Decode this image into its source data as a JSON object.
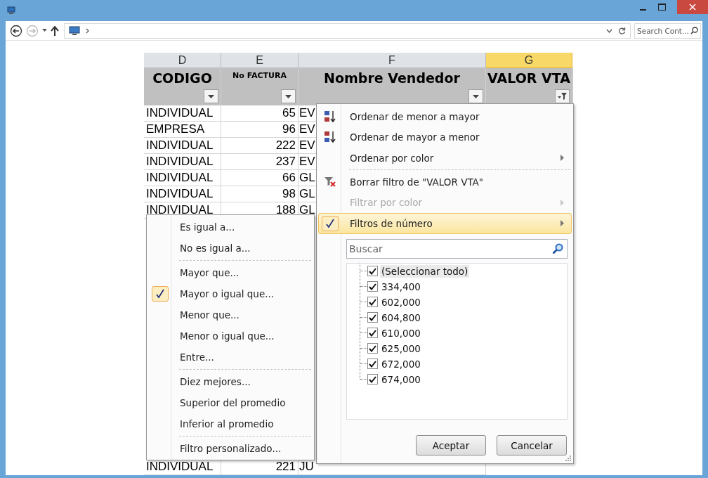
{
  "address_bar": {
    "search": {
      "placeholder": "Search Cont..."
    }
  },
  "sheet": {
    "columns": [
      {
        "letter": "D",
        "header": "CODIGO",
        "selected": false,
        "filtered": false
      },
      {
        "letter": "E",
        "header": "No FACTURA",
        "selected": false,
        "filtered": false
      },
      {
        "letter": "F",
        "header": "Nombre Vendedor",
        "selected": false,
        "filtered": false
      },
      {
        "letter": "G",
        "header": "VALOR VTA",
        "selected": true,
        "filtered": true
      }
    ],
    "rows": [
      {
        "cells": [
          "INDIVIDUAL",
          "65",
          "EV"
        ]
      },
      {
        "cells": [
          "EMPRESA",
          "96",
          "EV"
        ]
      },
      {
        "cells": [
          "INDIVIDUAL",
          "222",
          "EV"
        ]
      },
      {
        "cells": [
          "INDIVIDUAL",
          "237",
          "EV"
        ]
      },
      {
        "cells": [
          "INDIVIDUAL",
          "66",
          "GL"
        ]
      },
      {
        "cells": [
          "INDIVIDUAL",
          "98",
          "GL"
        ]
      },
      {
        "cells": [
          "INDIVIDUAL",
          "188",
          "GL"
        ]
      }
    ],
    "last_row": {
      "cells": [
        "INDIVIDUAL",
        "221",
        "JU"
      ]
    }
  },
  "filter_menu": {
    "items": [
      {
        "kind": "sort-ascending",
        "label": "Ordenar de menor a mayor",
        "disabled": false,
        "selected": false,
        "checked": false,
        "submenu": false
      },
      {
        "kind": "sort-descending",
        "label": "Ordenar de mayor a menor",
        "disabled": false,
        "selected": false,
        "checked": false,
        "submenu": false
      },
      {
        "kind": "command",
        "label": "Ordenar por color",
        "disabled": false,
        "selected": false,
        "checked": false,
        "submenu": true
      },
      {
        "kind": "separator"
      },
      {
        "kind": "clear-filter",
        "label": "Borrar filtro de \"VALOR VTA\"",
        "disabled": false,
        "selected": false,
        "checked": false,
        "submenu": false
      },
      {
        "kind": "command",
        "label": "Filtrar por color",
        "disabled": true,
        "selected": false,
        "checked": false,
        "submenu": true
      },
      {
        "kind": "command",
        "label": "Filtros de número",
        "disabled": false,
        "selected": true,
        "checked": true,
        "submenu": true
      }
    ],
    "search": {
      "placeholder": "Buscar"
    },
    "values": [
      {
        "label": "(Seleccionar todo)",
        "checked": true,
        "selected": true
      },
      {
        "label": "334,400",
        "checked": true,
        "selected": false
      },
      {
        "label": "602,000",
        "checked": true,
        "selected": false
      },
      {
        "label": "604,800",
        "checked": true,
        "selected": false
      },
      {
        "label": "610,000",
        "checked": true,
        "selected": false
      },
      {
        "label": "625,000",
        "checked": true,
        "selected": false
      },
      {
        "label": "672,000",
        "checked": true,
        "selected": false
      },
      {
        "label": "674,000",
        "checked": true,
        "selected": false
      }
    ],
    "buttons": [
      "Aceptar",
      "Cancelar"
    ]
  },
  "number_filters": {
    "items": [
      {
        "kind": "command",
        "label": "Es igual a...",
        "checked": false
      },
      {
        "kind": "command",
        "label": "No es igual a...",
        "checked": false
      },
      {
        "kind": "separator"
      },
      {
        "kind": "command",
        "label": "Mayor que...",
        "checked": false
      },
      {
        "kind": "command",
        "label": "Mayor o igual que...",
        "checked": true
      },
      {
        "kind": "command",
        "label": "Menor que...",
        "checked": false
      },
      {
        "kind": "command",
        "label": "Menor o igual que...",
        "checked": false
      },
      {
        "kind": "command",
        "label": "Entre...",
        "checked": false
      },
      {
        "kind": "separator"
      },
      {
        "kind": "command",
        "label": "Diez mejores...",
        "checked": false
      },
      {
        "kind": "command",
        "label": "Superior del promedio",
        "checked": false
      },
      {
        "kind": "command",
        "label": "Inferior al promedio",
        "checked": false
      },
      {
        "kind": "separator"
      },
      {
        "kind": "command",
        "label": "Filtro personalizado...",
        "checked": false
      }
    ]
  }
}
